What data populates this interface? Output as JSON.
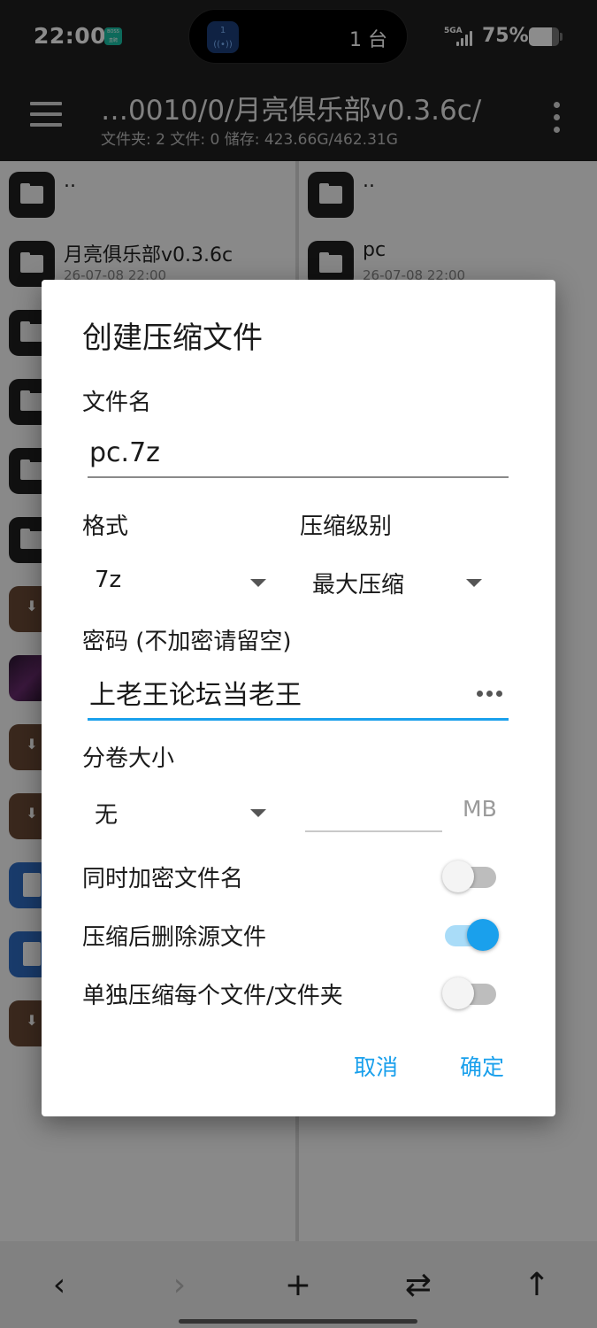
{
  "status_bar": {
    "time": "22:00",
    "app_badge": "BOSS 直聘",
    "island_count": "1 台",
    "network": "5GA",
    "battery_percent": "75%",
    "battery_level": 0.75
  },
  "toolbar": {
    "path": "…0010/0/月亮俱乐部v0.3.6c/",
    "stats": "文件夹: 2  文件: 0  储存: 423.66G/462.31G"
  },
  "left_pane": {
    "rows": [
      {
        "name": "..",
        "date": "",
        "type": "folder"
      },
      {
        "name": "月亮俱乐部v0.3.6c",
        "date": "26-07-08 22:00",
        "type": "folder"
      },
      {
        "name": "",
        "date": "",
        "type": "folder"
      },
      {
        "name": "",
        "date": "",
        "type": "folder"
      },
      {
        "name": "",
        "date": "",
        "type": "folder"
      },
      {
        "name": "",
        "date": "",
        "type": "folder"
      },
      {
        "name": "",
        "date": "",
        "type": "archive"
      },
      {
        "name": "",
        "date": "",
        "type": "image"
      },
      {
        "name": "",
        "date": "",
        "type": "archive"
      },
      {
        "name": "",
        "date": "",
        "type": "archive"
      },
      {
        "name": "",
        "date": "",
        "type": "doc"
      },
      {
        "name": "",
        "date": "",
        "type": "doc"
      },
      {
        "name": "",
        "date": "",
        "type": "archive"
      }
    ]
  },
  "right_pane": {
    "rows": [
      {
        "name": "..",
        "date": "",
        "type": "folder"
      },
      {
        "name": "pc",
        "date": "26-07-08 22:00",
        "type": "folder"
      }
    ]
  },
  "bottom_nav": {
    "back": "‹",
    "forward": "›",
    "add": "+",
    "swap": "⇄",
    "up": "↑"
  },
  "dialog": {
    "title": "创建压缩文件",
    "filename_label": "文件名",
    "filename_value": "pc.7z",
    "format_label": "格式",
    "format_value": "7z",
    "level_label": "压缩级别",
    "level_value": "最大压缩",
    "password_label": "密码 (不加密请留空)",
    "password_value": "上老王论坛当老王",
    "split_label": "分卷大小",
    "split_value": "无",
    "split_size_value": "",
    "split_unit": "MB",
    "toggles": [
      {
        "label": "同时加密文件名",
        "on": false
      },
      {
        "label": "压缩后删除源文件",
        "on": true
      },
      {
        "label": "单独压缩每个文件/文件夹",
        "on": false
      }
    ],
    "cancel_label": "取消",
    "ok_label": "确定"
  }
}
